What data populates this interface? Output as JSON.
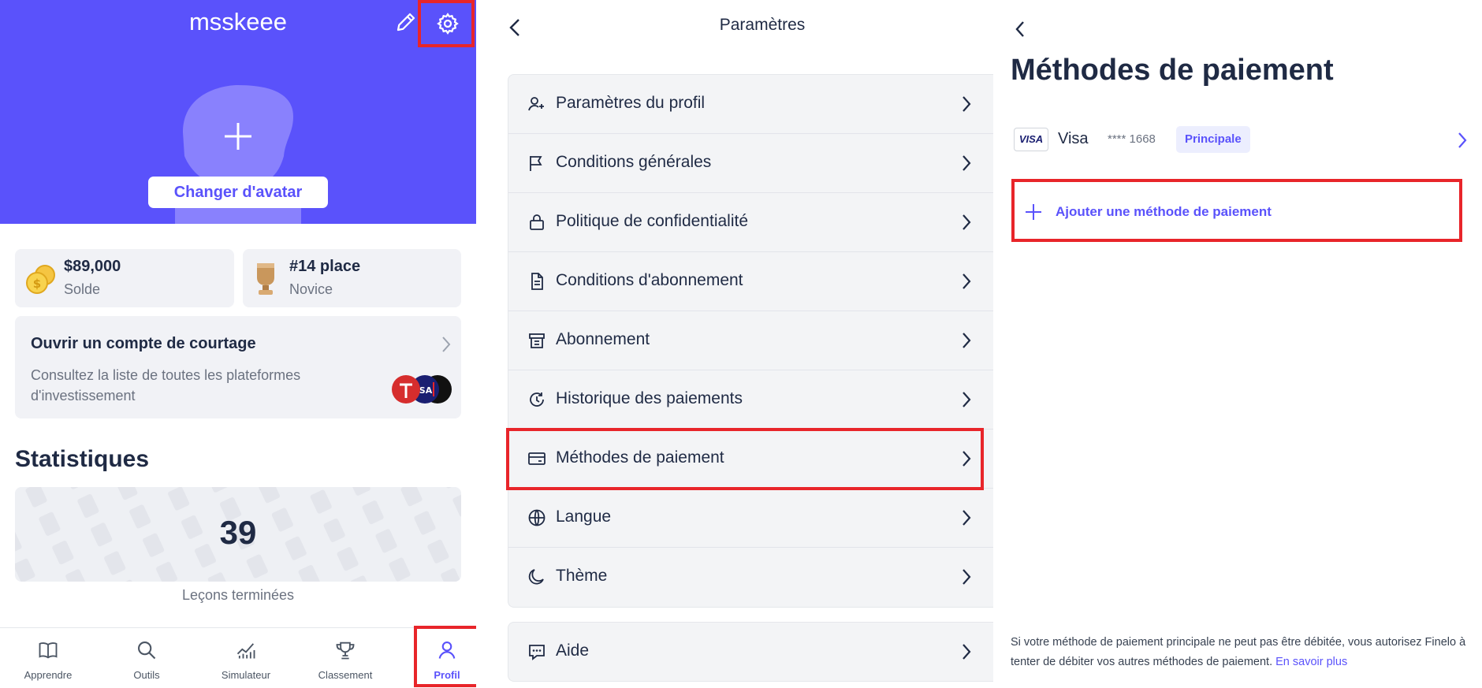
{
  "colors": {
    "accent": "#5a52fb",
    "highlight": "#e8252a",
    "text": "#1f2a44",
    "muted": "#6b7280"
  },
  "profile": {
    "username": "msskeee",
    "change_avatar_label": "Changer d'avatar",
    "balance": {
      "value": "$89,000",
      "label": "Solde"
    },
    "rank": {
      "value": "#14 place",
      "label": "Novice"
    },
    "broker": {
      "title": "Ouvrir un compte de courtage",
      "description": "Consultez la liste de toutes les plateformes d'investissement"
    },
    "stats_title": "Statistiques",
    "lessons": {
      "value": "39",
      "label": "Leçons terminées"
    },
    "tabs": [
      {
        "label": "Apprendre",
        "icon": "book-icon"
      },
      {
        "label": "Outils",
        "icon": "search-icon"
      },
      {
        "label": "Simulateur",
        "icon": "chart-icon"
      },
      {
        "label": "Classement",
        "icon": "trophy-icon"
      },
      {
        "label": "Profil",
        "icon": "user-icon",
        "active": true
      }
    ]
  },
  "settings": {
    "title": "Paramètres",
    "items": [
      {
        "label": "Paramètres du profil",
        "icon": "user-settings-icon"
      },
      {
        "label": "Conditions générales",
        "icon": "flag-icon"
      },
      {
        "label": "Politique de confidentialité",
        "icon": "lock-icon"
      },
      {
        "label": "Conditions d'abonnement",
        "icon": "document-icon"
      },
      {
        "label": "Abonnement",
        "icon": "subscription-icon"
      },
      {
        "label": "Historique des paiements",
        "icon": "history-icon"
      },
      {
        "label": "Méthodes de paiement",
        "icon": "card-icon"
      },
      {
        "label": "Langue",
        "icon": "globe-icon"
      },
      {
        "label": "Thème",
        "icon": "moon-icon"
      }
    ],
    "help": {
      "label": "Aide",
      "icon": "chat-icon"
    }
  },
  "payment": {
    "title": "Méthodes de paiement",
    "card": {
      "logo": "VISA",
      "name": "Visa",
      "digits": "**** 1668",
      "badge": "Principale"
    },
    "add_label": "Ajouter une méthode de paiement",
    "footer_text": "Si votre méthode de paiement principale ne peut pas être débitée, vous autorisez Finelo à tenter de débiter vos autres méthodes de paiement.",
    "footer_link": "En savoir plus"
  }
}
